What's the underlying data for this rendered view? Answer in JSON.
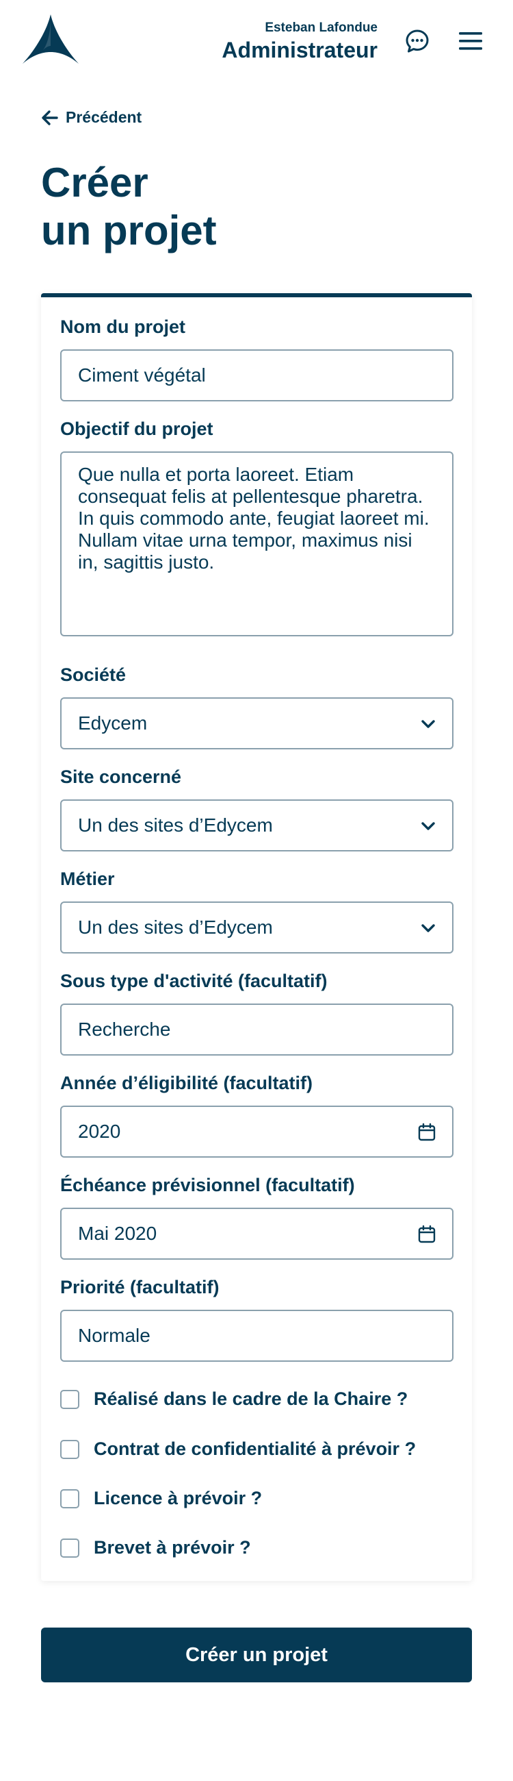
{
  "header": {
    "user_name": "Esteban Lafondue",
    "user_role": "Administrateur",
    "logo_icon": "triangle-logo-icon",
    "chat_icon": "chat-bubble-icon",
    "menu_icon": "hamburger-menu-icon"
  },
  "nav": {
    "back_label": "Précédent"
  },
  "page": {
    "title_line1": "Créer",
    "title_line2": "un projet"
  },
  "form": {
    "project_name": {
      "label": "Nom du projet",
      "value": "Ciment végétal"
    },
    "objective": {
      "label": "Objectif du projet",
      "value": "Que nulla et porta laoreet. Etiam consequat felis at pellentesque pharetra. In quis commodo ante, feugiat laoreet mi. Nullam vitae urna tempor, maximus nisi in, sagittis justo."
    },
    "company": {
      "label": "Société",
      "value": "Edycem"
    },
    "site": {
      "label": "Site concerné",
      "value": "Un des sites d’Edycem"
    },
    "job": {
      "label": "Métier",
      "value": "Un des sites d’Edycem"
    },
    "subtype": {
      "label": "Sous type d'activité (facultatif)",
      "value": "Recherche"
    },
    "eligibility_year": {
      "label": "Année d’éligibilité (facultatif)",
      "value": "2020"
    },
    "deadline": {
      "label": "Échéance prévisionnel (facultatif)",
      "value": "Mai 2020"
    },
    "priority": {
      "label": "Priorité (facultatif)",
      "value": "Normale"
    },
    "checkboxes": [
      {
        "label": "Réalisé dans le cadre de la Chaire ?",
        "checked": false
      },
      {
        "label": "Contrat de confidentialité à prévoir ?",
        "checked": false
      },
      {
        "label": "Licence à prévoir ?",
        "checked": false
      },
      {
        "label": "Brevet à prévoir ?",
        "checked": false
      }
    ],
    "submit_label": "Créer un projet"
  },
  "colors": {
    "primary": "#063a55",
    "border": "#8aa0ad"
  }
}
